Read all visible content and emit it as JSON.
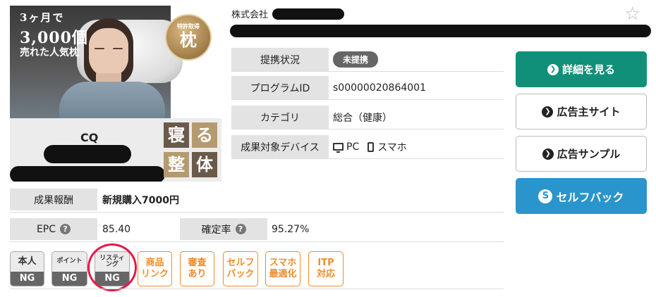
{
  "banner": {
    "line1": "3ヶ月で",
    "line2": "3,000個",
    "line3": "売れた人気枕",
    "seal_top": "特許取得",
    "seal_main": "枕",
    "logo_mark": "CQ",
    "tiles": [
      "寝",
      "る",
      "整",
      "体"
    ]
  },
  "company": {
    "prefix": "株式会社"
  },
  "info": {
    "status_label": "提携状況",
    "status_value": "未提携",
    "program_label": "プログラムID",
    "program_value": "s00000020864001",
    "category_label": "カテゴリ",
    "category_value": "総合（健康）",
    "device_label": "成果対象デバイス",
    "device_pc": "PC",
    "device_phone": "スマホ"
  },
  "stats": {
    "reward_label": "成果報酬",
    "reward_value": "新規購入7000円",
    "epc_label": "EPC",
    "epc_value": "85.40",
    "rate_label": "確定率",
    "rate_value": "95.27%",
    "help_glyph": "?"
  },
  "badges": {
    "self": {
      "top": "本人",
      "bottom": "NG"
    },
    "point": {
      "top": "ポイント",
      "bottom": "NG"
    },
    "listing": {
      "top_line1": "リスティ",
      "top_line2": "ング",
      "bottom": "NG"
    },
    "product_link": [
      "商品",
      "リンク"
    ],
    "review": [
      "審査",
      "あり"
    ],
    "selfback": [
      "セルフ",
      "バック"
    ],
    "mobile": [
      "スマホ",
      "最適化"
    ],
    "itp": [
      "ITP",
      "対応"
    ]
  },
  "actions": {
    "details": "詳細を見る",
    "advertiser_site": "広告主サイト",
    "ad_sample": "広告サンプル",
    "self_back": "セルフバック"
  },
  "colors": {
    "primary": "#119079",
    "self_back": "#2a95cc",
    "ok_badge": "#f08c2c",
    "highlight": "#e8184a"
  }
}
